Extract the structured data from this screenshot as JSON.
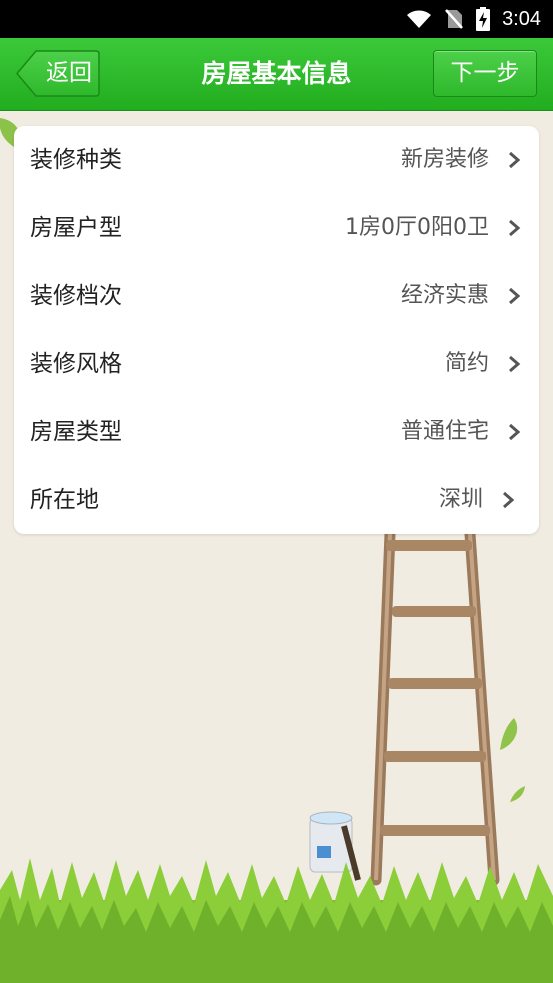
{
  "status_bar": {
    "time": "3:04",
    "icons": [
      "wifi-icon",
      "no-sim-icon",
      "battery-charging-icon"
    ]
  },
  "header": {
    "back_label": "返回",
    "title": "房屋基本信息",
    "next_label": "下一步"
  },
  "colors": {
    "header_green": "#22ad1f",
    "background": "#f1ece1"
  },
  "rows": [
    {
      "label": "装修种类",
      "value": "新房装修"
    },
    {
      "label": "房屋户型",
      "value": "1房0厅0阳0卫"
    },
    {
      "label": "装修档次",
      "value": "经济实惠"
    },
    {
      "label": "装修风格",
      "value": "简约"
    },
    {
      "label": "房屋类型",
      "value": "普通住宅"
    },
    {
      "label": "所在地",
      "value": "深圳"
    }
  ]
}
